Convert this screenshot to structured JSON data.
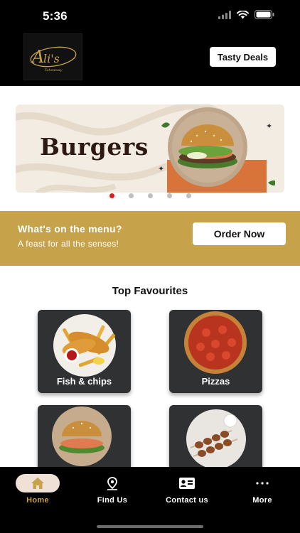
{
  "status_bar": {
    "time": "5:36"
  },
  "header": {
    "logo_text": "Ali's",
    "logo_subtext": "Takeaway",
    "deals_button": "Tasty Deals"
  },
  "banner": {
    "title": "Burgers",
    "carousel_index": 1,
    "carousel_count": 5
  },
  "menu_strip": {
    "title": "What's on the menu?",
    "subtitle": "A feast for all the senses!",
    "order_button": "Order Now"
  },
  "favourites": {
    "heading": "Top Favourites",
    "items": [
      {
        "label": "Fish & chips"
      },
      {
        "label": "Pizzas"
      },
      {
        "label": ""
      },
      {
        "label": ""
      }
    ]
  },
  "bottom_nav": {
    "items": [
      {
        "label": "Home",
        "icon": "home-icon",
        "active": true
      },
      {
        "label": "Find Us",
        "icon": "map-pin-icon",
        "active": false
      },
      {
        "label": "Contact us",
        "icon": "contact-card-icon",
        "active": false
      },
      {
        "label": "More",
        "icon": "more-icon",
        "active": false
      }
    ]
  },
  "colors": {
    "header_bg": "#000000",
    "accent_gold": "#c6a24a",
    "carousel_active_dot": "#d82020",
    "nav_active_pill": "#efe1d6"
  }
}
